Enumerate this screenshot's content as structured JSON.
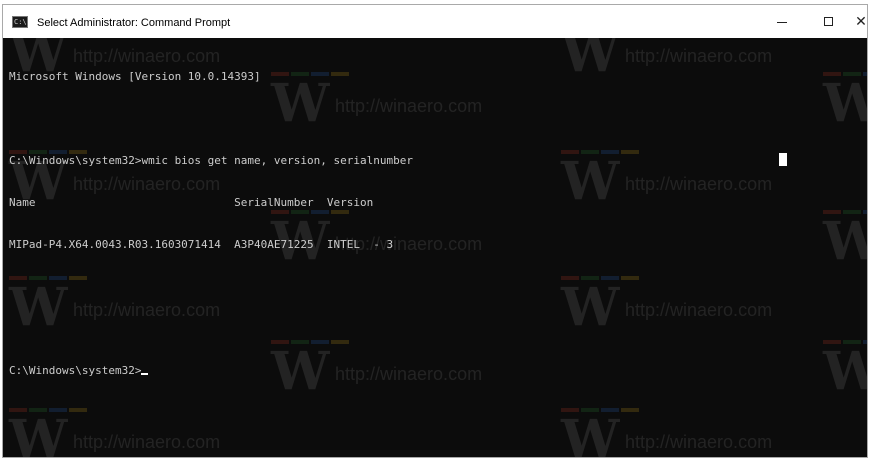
{
  "window": {
    "title": "Select Administrator: Command Prompt",
    "icon": "cmd-icon",
    "controls": {
      "minimize": "minimize-icon",
      "maximize": "maximize-icon",
      "close": "✕"
    }
  },
  "console": {
    "lines": [
      "Microsoft Windows [Version 10.0.14393]",
      "",
      "C:\\Windows\\system32>wmic bios get name, version, serialnumber",
      "Name                              SerialNumber  Version",
      "MIPad-P4.X64.0043.R03.1603071414  A3P40AE71225  INTEL  - 3",
      "",
      "",
      "C:\\Windows\\system32>"
    ],
    "text_color": "#cccccc",
    "background": "#0c0c0c"
  },
  "watermark": {
    "text": "http://winaero.com",
    "glyph": "W"
  }
}
